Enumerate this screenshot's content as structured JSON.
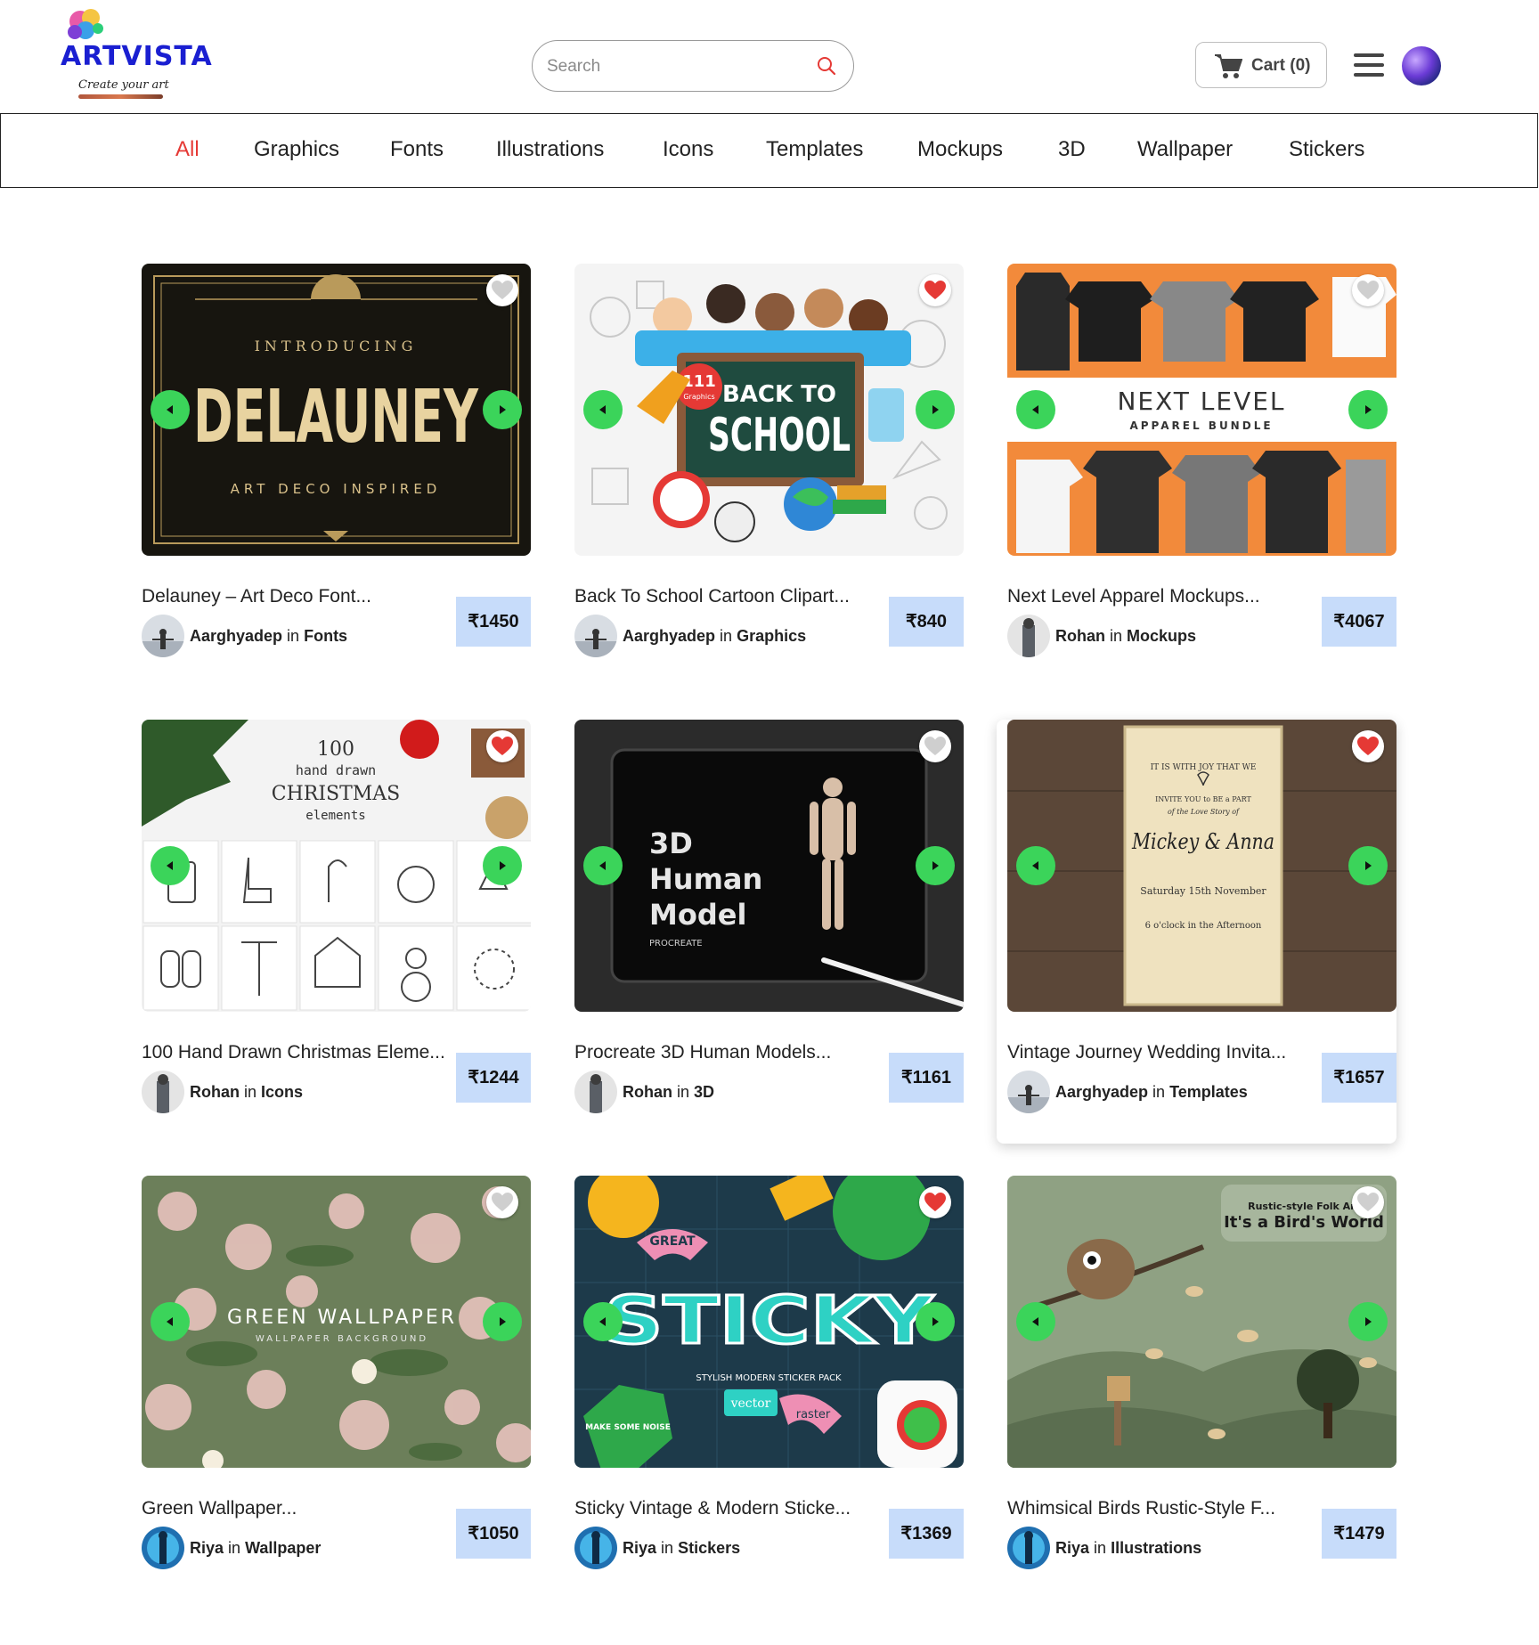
{
  "brand": {
    "name": "ARTVISTA",
    "tagline": "Create your art"
  },
  "search": {
    "placeholder": "Search"
  },
  "cart": {
    "label": "Cart (0)"
  },
  "colors": {
    "accent_nav": "#e53935",
    "price_bg": "#c7dcfa",
    "arrow": "#3bd45a",
    "brand": "#1a1fd1",
    "heart_active": "#e53935"
  },
  "nav": {
    "items": [
      "All",
      "Graphics",
      "Fonts",
      "Illustrations",
      "Icons",
      "Templates",
      "Mockups",
      "3D",
      "Wallpaper",
      "Stickers"
    ],
    "active": "All"
  },
  "products": [
    {
      "title": "Delauney – Art Deco Font...",
      "author": "Aarghyadep",
      "in": "in",
      "category": "Fonts",
      "price": "₹1450",
      "liked": false,
      "art": {
        "line1": "INTRODUCING",
        "line2": "DELAUNEY",
        "line3": "ART DECO INSPIRED"
      }
    },
    {
      "title": "Back To School Cartoon Clipart...",
      "author": "Aarghyadep",
      "in": "in",
      "category": "Graphics",
      "price": "₹840",
      "liked": true,
      "art": {
        "badge": "111",
        "badge_sub": "Graphics",
        "line1": "BACK TO",
        "line2": "SCHOOL"
      }
    },
    {
      "title": "Next Level Apparel Mockups...",
      "author": "Rohan",
      "in": "in",
      "category": "Mockups",
      "price": "₹4067",
      "liked": false,
      "art": {
        "line1": "NEXT LEVEL",
        "line2": "APPAREL BUNDLE"
      }
    },
    {
      "title": "100 Hand Drawn Christmas Eleme...",
      "author": "Rohan",
      "in": "in",
      "category": "Icons",
      "price": "₹1244",
      "liked": true,
      "art": {
        "line1": "100",
        "line2": "hand drawn",
        "line3": "CHRISTMAS",
        "line4": "elements"
      }
    },
    {
      "title": "Procreate 3D Human Models...",
      "author": "Rohan",
      "in": "in",
      "category": "3D",
      "price": "₹1161",
      "liked": false,
      "art": {
        "line1": "3D",
        "line2": "Human",
        "line3": "Model",
        "line4": "PROCREATE"
      }
    },
    {
      "title": "Vintage Journey Wedding Invita...",
      "author": "Aarghyadep",
      "in": "in",
      "category": "Templates",
      "price": "₹1657",
      "liked": true,
      "art": {
        "line1": "IT IS WITH JOY THAT WE",
        "line2": "INVITE YOU to BE a PART",
        "line3": "of the Love Story of",
        "line4": "Mickey & Anna",
        "line5": "Saturday 15th November",
        "line6": "6 o'clock in the Afternoon"
      }
    },
    {
      "title": "Green Wallpaper...",
      "author": "Riya",
      "in": "in",
      "category": "Wallpaper",
      "price": "₹1050",
      "liked": false,
      "art": {
        "line1": "GREEN WALLPAPER",
        "line2": "WALLPAPER BACKGROUND"
      }
    },
    {
      "title": "Sticky Vintage & Modern Sticke...",
      "author": "Riya",
      "in": "in",
      "category": "Stickers",
      "price": "₹1369",
      "liked": true,
      "art": {
        "line1": "STICKY",
        "line2": "STYLISH MODERN STICKER PACK",
        "line3": "vector",
        "line4": "raster",
        "line5": "GREAT",
        "line6": "MAKE SOME NOISE"
      }
    },
    {
      "title": "Whimsical Birds Rustic-Style F...",
      "author": "Riya",
      "in": "in",
      "category": "Illustrations",
      "price": "₹1479",
      "liked": false,
      "art": {
        "line1": "Rustic-style Folk Art",
        "line2": "It's a Bird's World"
      }
    }
  ]
}
